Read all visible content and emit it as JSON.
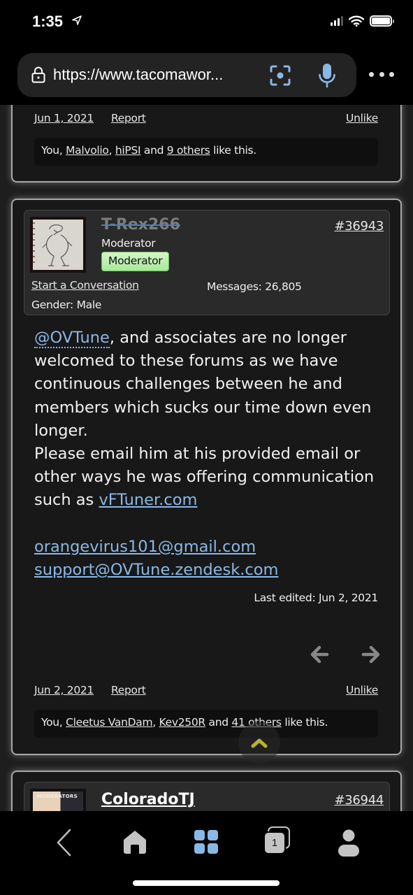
{
  "status_bar": {
    "time": "1:35",
    "icons": [
      "location-arrow-icon",
      "cellular-signal-icon",
      "wifi-icon",
      "battery-icon"
    ]
  },
  "browser": {
    "url": "https://www.tacomawor...",
    "icons": [
      "lock-icon",
      "scan-icon",
      "microphone-icon",
      "more-icon"
    ],
    "accent_color": "#8ab8e6"
  },
  "posts": [
    {
      "date": "Jun 1, 2021",
      "report_label": "Report",
      "unlike_label": "Unlike",
      "likes": {
        "prefix": "You, ",
        "users": [
          "Malvolio",
          "hiPSI"
        ],
        "and": " and ",
        "others": "9 others",
        "suffix": " like this."
      }
    },
    {
      "username": "T-Rex266",
      "user_title": "Moderator",
      "banner": "Moderator",
      "banner_color": "#b8ecab",
      "post_number": "#36943",
      "start_conversation": "Start a Conversation",
      "messages_label": "Messages:",
      "messages_value": "26,805",
      "gender_label": "Gender:",
      "gender_value": "Male",
      "body": {
        "mention": "@OVTune",
        "text1": ", and associates are no longer welcomed to these forums as we have continuous challenges between he and members which sucks our time down even longer.",
        "text2": "Please email him at his provided email or other ways he was offering communication such as ",
        "link1": "vFTuner.com",
        "email1": "orangevirus101@gmail.com",
        "email2": "support@OVTune.zendesk.com"
      },
      "last_edited": "Last edited: Jun 2, 2021",
      "date": "Jun 2, 2021",
      "report_label": "Report",
      "unlike_label": "Unlike",
      "likes": {
        "prefix": "You, ",
        "users": [
          "Cleetus VanDam",
          "Kev250R"
        ],
        "and": " and ",
        "others": "41 others",
        "suffix": " like this."
      }
    },
    {
      "username": "ColoradoTJ",
      "post_number": "#36944",
      "avatar_caption": "MODERATORS"
    }
  ],
  "scroll_top": {
    "icon": "chevron-up-icon",
    "color": "#b5b52a"
  },
  "toolbar": {
    "items": [
      {
        "name": "back",
        "icon": "back-chevron-icon"
      },
      {
        "name": "home",
        "icon": "home-icon"
      },
      {
        "name": "apps",
        "icon": "grid-icon"
      },
      {
        "name": "tabs",
        "icon": "tabs-icon",
        "count": "1"
      },
      {
        "name": "account",
        "icon": "person-icon"
      }
    ]
  }
}
